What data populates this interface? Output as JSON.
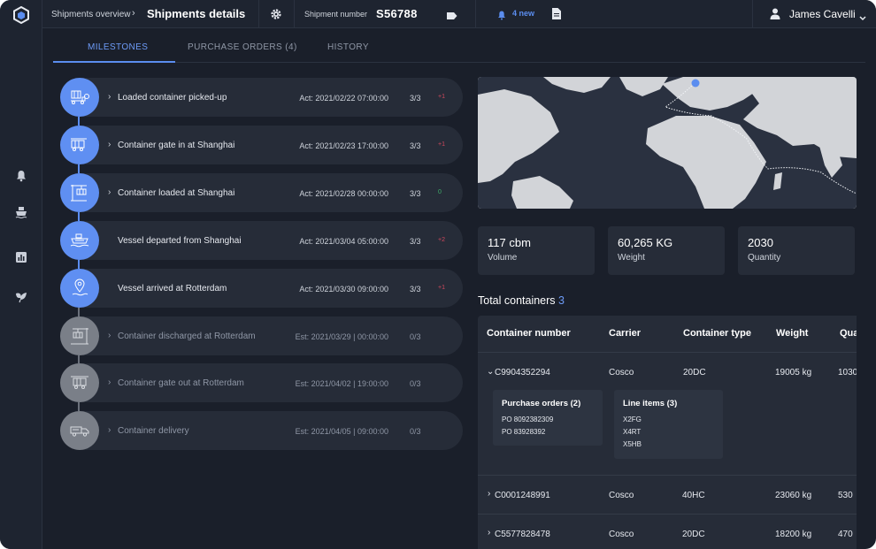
{
  "topbar": {
    "breadcrumb_parent": "Shipments overview",
    "page_title": "Shipments details",
    "shipment_number_label": "Shipment number",
    "shipment_number": "S56788",
    "notifications_new": "4 new",
    "user_name": "James Cavelli"
  },
  "tabs": [
    {
      "label": "MILESTONES",
      "active": true
    },
    {
      "label": "PURCHASE ORDERS (4)",
      "active": false
    },
    {
      "label": "HISTORY",
      "active": false
    }
  ],
  "sidebar": {
    "icons": [
      "bell-icon",
      "ship-icon",
      "chart-icon",
      "leaf-icon"
    ]
  },
  "milestones": [
    {
      "title": "Loaded container picked-up",
      "date": "Act: 2021/02/22 07:00:00",
      "count": "3/3",
      "delta": "+1",
      "status": "done",
      "icon": "truck-container-icon"
    },
    {
      "title": "Container gate in at Shanghai",
      "date": "Act: 2021/02/23 17:00:00",
      "count": "3/3",
      "delta": "+1",
      "status": "done",
      "icon": "gate-in-icon"
    },
    {
      "title": "Container loaded at Shanghai",
      "date": "Act: 2021/02/28 00:00:00",
      "count": "3/3",
      "delta": "0",
      "status": "done",
      "icon": "crane-load-icon"
    },
    {
      "title": "Vessel departed from Shanghai",
      "date": "Act: 2021/03/04 05:00:00",
      "count": "3/3",
      "delta": "+2",
      "status": "done",
      "icon": "vessel-icon"
    },
    {
      "title": "Vessel arrived at Rotterdam",
      "date": "Act: 2021/03/30 09:00:00",
      "count": "3/3",
      "delta": "+1",
      "status": "done",
      "icon": "location-pin-icon"
    },
    {
      "title": "Container discharged at Rotterdam",
      "date": "Est: 2021/03/29 | 00:00:00",
      "count": "0/3",
      "delta": "",
      "status": "todo",
      "icon": "crane-discharge-icon"
    },
    {
      "title": "Container gate out at Rotterdam",
      "date": "Est: 2021/04/02 | 19:00:00",
      "count": "0/3",
      "delta": "",
      "status": "todo",
      "icon": "gate-out-icon"
    },
    {
      "title": "Container delivery",
      "date": "Est: 2021/04/05 | 09:00:00",
      "count": "0/3",
      "delta": "",
      "status": "todo",
      "icon": "delivery-truck-icon"
    }
  ],
  "stats": [
    {
      "value": "117 cbm",
      "label": "Volume"
    },
    {
      "value": "60,265 KG",
      "label": "Weight"
    },
    {
      "value": "2030",
      "label": "Quantity"
    }
  ],
  "containers": {
    "title": "Total containers",
    "count": "3",
    "headers": [
      "Container number",
      "Carrier",
      "Container type",
      "Weight",
      "Qua"
    ],
    "rows": [
      {
        "number": "C9904352294",
        "carrier": "Cosco",
        "type": "20DC",
        "weight": "19005 kg",
        "qty": "1030",
        "expanded": true
      },
      {
        "number": "C0001248991",
        "carrier": "Cosco",
        "type": "40HC",
        "weight": "23060 kg",
        "qty": "530",
        "expanded": false
      },
      {
        "number": "C5577828478",
        "carrier": "Cosco",
        "type": "20DC",
        "weight": "18200 kg",
        "qty": "470",
        "expanded": false
      }
    ],
    "purchase_orders": {
      "title": "Purchase orders (2)",
      "items": [
        "PO 8092382309",
        "PO 83928392"
      ]
    },
    "line_items": {
      "title": "Line items (3)",
      "items": [
        "X2FG",
        "X4RT",
        "X5HB"
      ]
    }
  },
  "colors": {
    "accent": "#5b8def",
    "delta_positive": "#d0485d",
    "delta_zero": "#3fae6a",
    "background": "#1a1f2a",
    "panel": "#262c38"
  }
}
